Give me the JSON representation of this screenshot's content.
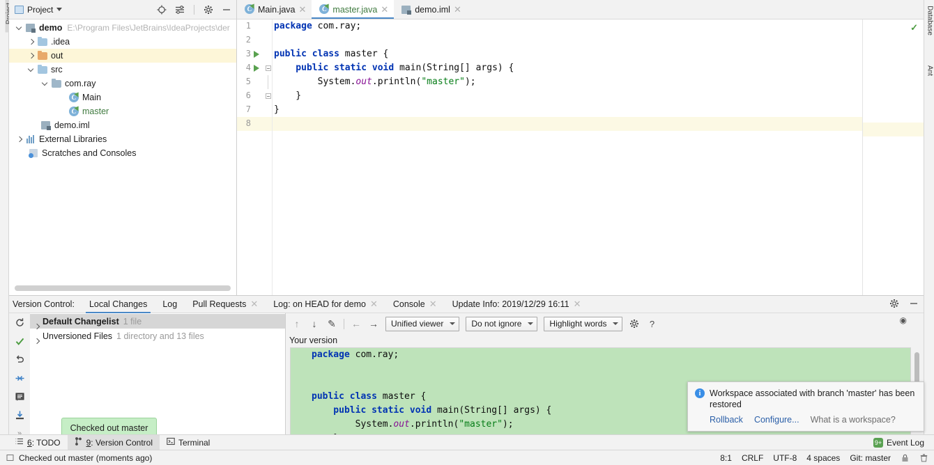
{
  "left_strip": {
    "label": "Project"
  },
  "right_strip": {
    "labels": [
      "Database",
      "Ant"
    ]
  },
  "project_panel": {
    "title": "Project",
    "title_icon": "project-window-icon",
    "header_buttons": [
      {
        "name": "locate-icon",
        "glyph": "⊕"
      },
      {
        "name": "collapse-all-icon",
        "glyph": "≡"
      },
      {
        "name": "gear-icon",
        "glyph": "⚙"
      },
      {
        "name": "hide-icon",
        "glyph": "—"
      }
    ],
    "tree": [
      {
        "label": "demo",
        "path": "E:\\Program Files\\JetBrains\\IdeaProjects\\der",
        "icon": "module-icon",
        "indent": 0,
        "arrow": "open",
        "bold": true,
        "highlight": false
      },
      {
        "label": ".idea",
        "path": "",
        "icon": "folder-icon",
        "indent": 1,
        "arrow": "closed",
        "bold": false,
        "highlight": false
      },
      {
        "label": "out",
        "path": "",
        "icon": "folder-excluded-icon",
        "indent": 1,
        "arrow": "closed",
        "bold": false,
        "highlight": true
      },
      {
        "label": "src",
        "path": "",
        "icon": "folder-source-icon",
        "indent": 1,
        "arrow": "open",
        "bold": false,
        "highlight": false
      },
      {
        "label": "com.ray",
        "path": "",
        "icon": "package-icon",
        "indent": 2,
        "arrow": "open",
        "bold": false,
        "highlight": false
      },
      {
        "label": "Main",
        "path": "",
        "icon": "java-class-icon",
        "indent": 3,
        "arrow": "none",
        "bold": false,
        "highlight": false
      },
      {
        "label": "master",
        "path": "",
        "icon": "java-class-icon",
        "indent": 3,
        "arrow": "none",
        "bold": false,
        "highlight": false,
        "green": true
      },
      {
        "label": "demo.iml",
        "path": "",
        "icon": "iml-file-icon",
        "indent": 2,
        "arrow": "none",
        "bold": false,
        "highlight": false
      },
      {
        "label": "External Libraries",
        "path": "",
        "icon": "libraries-icon",
        "indent": 0,
        "arrow": "closed",
        "bold": false,
        "highlight": false
      },
      {
        "label": "Scratches and Consoles",
        "path": "",
        "icon": "scratches-icon",
        "indent": 0,
        "arrow": "none",
        "bold": false,
        "highlight": false
      }
    ]
  },
  "editor": {
    "tabs": [
      {
        "label": "Main.java",
        "icon": "java-class-icon",
        "active": false,
        "green": false
      },
      {
        "label": "master.java",
        "icon": "java-class-icon",
        "active": true,
        "green": true
      },
      {
        "label": "demo.iml",
        "icon": "iml-file-icon",
        "active": false,
        "green": false
      }
    ],
    "lines": [
      {
        "num": "1",
        "run": false,
        "fold": "none",
        "current": false,
        "tokens": [
          {
            "t": "package ",
            "c": "kw"
          },
          {
            "t": "com.ray;",
            "c": "pln"
          }
        ]
      },
      {
        "num": "2",
        "run": false,
        "fold": "none",
        "current": false,
        "tokens": []
      },
      {
        "num": "3",
        "run": true,
        "fold": "none",
        "current": false,
        "tokens": [
          {
            "t": "public class ",
            "c": "kw"
          },
          {
            "t": "master {",
            "c": "pln"
          }
        ]
      },
      {
        "num": "4",
        "run": true,
        "fold": "start",
        "current": false,
        "tokens": [
          {
            "t": "    public static void ",
            "c": "kw"
          },
          {
            "t": "main(String[] args) {",
            "c": "pln"
          }
        ]
      },
      {
        "num": "5",
        "run": false,
        "fold": "line",
        "current": false,
        "tokens": [
          {
            "t": "        System.",
            "c": "pln"
          },
          {
            "t": "out",
            "c": "fld"
          },
          {
            "t": ".println(",
            "c": "pln"
          },
          {
            "t": "\"master\"",
            "c": "str"
          },
          {
            "t": ");",
            "c": "pln"
          }
        ]
      },
      {
        "num": "6",
        "run": false,
        "fold": "end",
        "current": false,
        "tokens": [
          {
            "t": "    }",
            "c": "pln"
          }
        ]
      },
      {
        "num": "7",
        "run": false,
        "fold": "none",
        "current": false,
        "tokens": [
          {
            "t": "}",
            "c": "pln"
          }
        ]
      },
      {
        "num": "8",
        "run": false,
        "fold": "none",
        "current": true,
        "tokens": []
      }
    ],
    "inspection_status": "ok"
  },
  "vcs": {
    "title": "Version Control:",
    "tabs": [
      {
        "label": "Local Changes",
        "active": true,
        "closable": false
      },
      {
        "label": "Log",
        "active": false,
        "closable": false
      },
      {
        "label": "Pull Requests",
        "active": false,
        "closable": true
      },
      {
        "label": "Log: on HEAD for demo",
        "active": false,
        "closable": true
      },
      {
        "label": "Console",
        "active": false,
        "closable": true
      },
      {
        "label": "Update Info: 2019/12/29 16:11",
        "active": false,
        "closable": true
      }
    ],
    "header_buttons": [
      {
        "name": "settings-gear-icon",
        "glyph": "⚙"
      },
      {
        "name": "hide-panel-icon",
        "glyph": "—"
      }
    ],
    "left_tools": [
      {
        "name": "refresh-icon",
        "glyph": "↻"
      },
      {
        "name": "commit-check-icon",
        "glyph": "✓"
      },
      {
        "name": "rollback-icon",
        "glyph": "↶"
      },
      {
        "name": "shelve-icon",
        "glyph": "⇥"
      },
      {
        "name": "show-diff-icon",
        "glyph": "▤"
      },
      {
        "name": "get-from-vcs-icon",
        "glyph": "⤓"
      },
      {
        "name": "more-options-icon",
        "glyph": "»"
      }
    ],
    "changes": [
      {
        "name": "Default Changelist",
        "meta": "1 file",
        "selected": true
      },
      {
        "name": "Unversioned Files",
        "meta": "1 directory and 13 files",
        "selected": false
      }
    ],
    "diff_toolbar": {
      "icons": [
        {
          "name": "previous-difference-icon",
          "glyph": "↑"
        },
        {
          "name": "next-difference-icon",
          "glyph": "↓"
        },
        {
          "name": "edit-source-icon",
          "glyph": "✎"
        },
        {
          "name": "previous-file-icon",
          "glyph": "←"
        },
        {
          "name": "next-file-icon",
          "glyph": "→"
        }
      ],
      "viewer_mode": "Unified viewer",
      "ignore_policy": "Do not ignore",
      "highlight_policy": "Highlight words",
      "settings_icon": "diff-settings-gear-icon",
      "help_icon": "help-question-icon"
    },
    "diff_label": "Your version",
    "diff_lines": [
      [
        {
          "t": "package ",
          "c": "kw"
        },
        {
          "t": "com.ray;",
          "c": "pln"
        }
      ],
      [],
      [],
      [
        {
          "t": "public class ",
          "c": "kw"
        },
        {
          "t": "master {",
          "c": "pln"
        }
      ],
      [
        {
          "t": "    public static void ",
          "c": "kw"
        },
        {
          "t": "main(String[] args) {",
          "c": "pln"
        }
      ],
      [
        {
          "t": "        System.",
          "c": "pln"
        },
        {
          "t": "out",
          "c": "fld"
        },
        {
          "t": ".println(",
          "c": "pln"
        },
        {
          "t": "\"master\"",
          "c": "str"
        },
        {
          "t": ");",
          "c": "pln"
        }
      ],
      [
        {
          "t": "    }",
          "c": "pln"
        }
      ],
      [
        {
          "t": "}",
          "c": "pln"
        }
      ]
    ]
  },
  "notification": {
    "icon": "info-icon",
    "message": "Workspace associated with branch 'master' has been restored",
    "links": [
      {
        "label": "Rollback",
        "muted": false
      },
      {
        "label": "Configure...",
        "muted": false
      },
      {
        "label": "What is a workspace?",
        "muted": true
      }
    ]
  },
  "tooltip": {
    "text": "Checked out master"
  },
  "toolwindow_bar": {
    "items": [
      {
        "num": "6",
        "label": ": TODO",
        "icon": "todo-list-icon",
        "active": false
      },
      {
        "num": "9",
        "label": ": Version Control",
        "icon": "version-control-icon",
        "active": true
      },
      {
        "num": "",
        "label": "Terminal",
        "icon": "terminal-icon",
        "active": false
      }
    ],
    "event_log": {
      "label": "Event Log",
      "badge": "9+"
    }
  },
  "statusbar": {
    "message": "Checked out master (moments ago)",
    "message_icon": "notification-icon",
    "right": [
      {
        "name": "caret-position",
        "label": "8:1"
      },
      {
        "name": "line-separator",
        "label": "CRLF"
      },
      {
        "name": "file-encoding",
        "label": "UTF-8"
      },
      {
        "name": "indent-size",
        "label": "4 spaces"
      },
      {
        "name": "git-branch",
        "label": "Git: master"
      }
    ],
    "icons": [
      {
        "name": "lock-icon",
        "glyph": "ὑ2"
      },
      {
        "name": "memory-indicator-icon",
        "glyph": "☗"
      }
    ]
  },
  "colors": {
    "accent": "#4a88c7",
    "diff_added_bg": "#bee3ba",
    "tooltip_bg": "#c6eec6",
    "keyword": "#0033b3",
    "string": "#067d17",
    "field": "#871094",
    "green_text": "#3f7a3f"
  }
}
